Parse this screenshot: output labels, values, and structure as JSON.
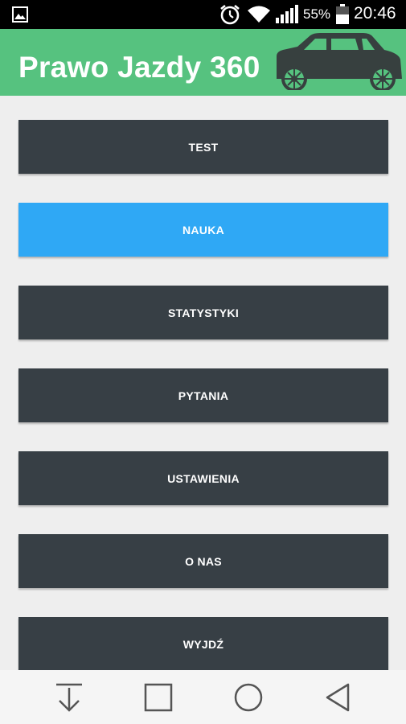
{
  "status_bar": {
    "battery_percent": "55%",
    "time": "20:46",
    "icons": [
      "image-icon",
      "alarm-icon",
      "wifi-icon",
      "signal-icon",
      "battery-icon"
    ]
  },
  "app_bar": {
    "title": "Prawo Jazdy 360",
    "color": "#56c27f",
    "logo_icon": "car-icon"
  },
  "menu": {
    "items": [
      {
        "label": "TEST",
        "active": false
      },
      {
        "label": "NAUKA",
        "active": true
      },
      {
        "label": "STATYSTYKI",
        "active": false
      },
      {
        "label": "PYTANIA",
        "active": false
      },
      {
        "label": "USTAWIENIA",
        "active": false
      },
      {
        "label": "O NAS",
        "active": false
      },
      {
        "label": "WYJDŹ",
        "active": false
      }
    ],
    "button_color": "#373f45",
    "active_color": "#2fa8f5"
  },
  "nav_bar": {
    "icons": [
      "download-icon",
      "recents-icon",
      "home-icon",
      "back-icon"
    ]
  }
}
